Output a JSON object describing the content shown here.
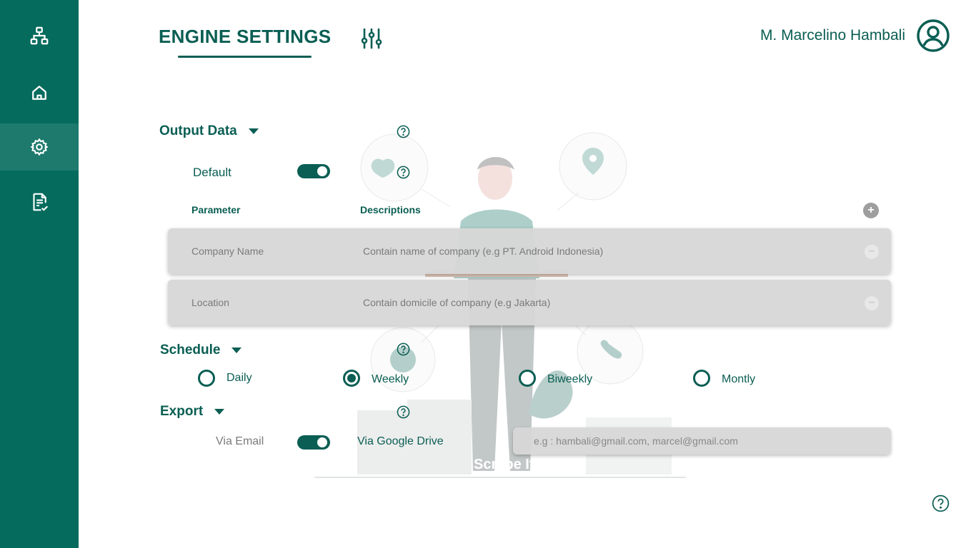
{
  "sidebar": {
    "items": [
      {
        "icon": "hierarchy-icon",
        "active": false
      },
      {
        "icon": "home-icon",
        "active": false
      },
      {
        "icon": "gear-icon",
        "active": true
      },
      {
        "icon": "document-check-icon",
        "active": false
      }
    ]
  },
  "header": {
    "title": "ENGINE SETTINGS",
    "user_name": "M. Marcelino Hambali"
  },
  "output_data": {
    "heading": "Output Data",
    "default_label": "Default",
    "default_on": true,
    "columns": {
      "parameter": "Parameter",
      "descriptions": "Descriptions"
    },
    "add_label": "+",
    "remove_label": "−",
    "rows": [
      {
        "name": "Company Name",
        "description": "Contain name of company (e.g PT. Android Indonesia)"
      },
      {
        "name": "Location",
        "description": "Contain domicile of company (e.g Jakarta)"
      }
    ]
  },
  "schedule": {
    "heading": "Schedule",
    "options": [
      {
        "label": "Daily",
        "checked": false
      },
      {
        "label": "Weekly",
        "checked": true
      },
      {
        "label": "Biweekly",
        "checked": false
      },
      {
        "label": "Montly",
        "checked": false
      }
    ]
  },
  "export": {
    "heading": "Export",
    "via_email_label": "Via Email",
    "via_drive_label": "Via Google Drive",
    "toggle_on": true,
    "email_placeholder": "e.g : hambali@gmail.com, marcel@gmail.com"
  },
  "illustration": {
    "caption": "Scrape It!"
  },
  "colors": {
    "primary": "#0a5e53",
    "sidebar": "#056b5d",
    "sidebar_active": "#1d7a6d",
    "row_bg": "#d7d7d7"
  }
}
